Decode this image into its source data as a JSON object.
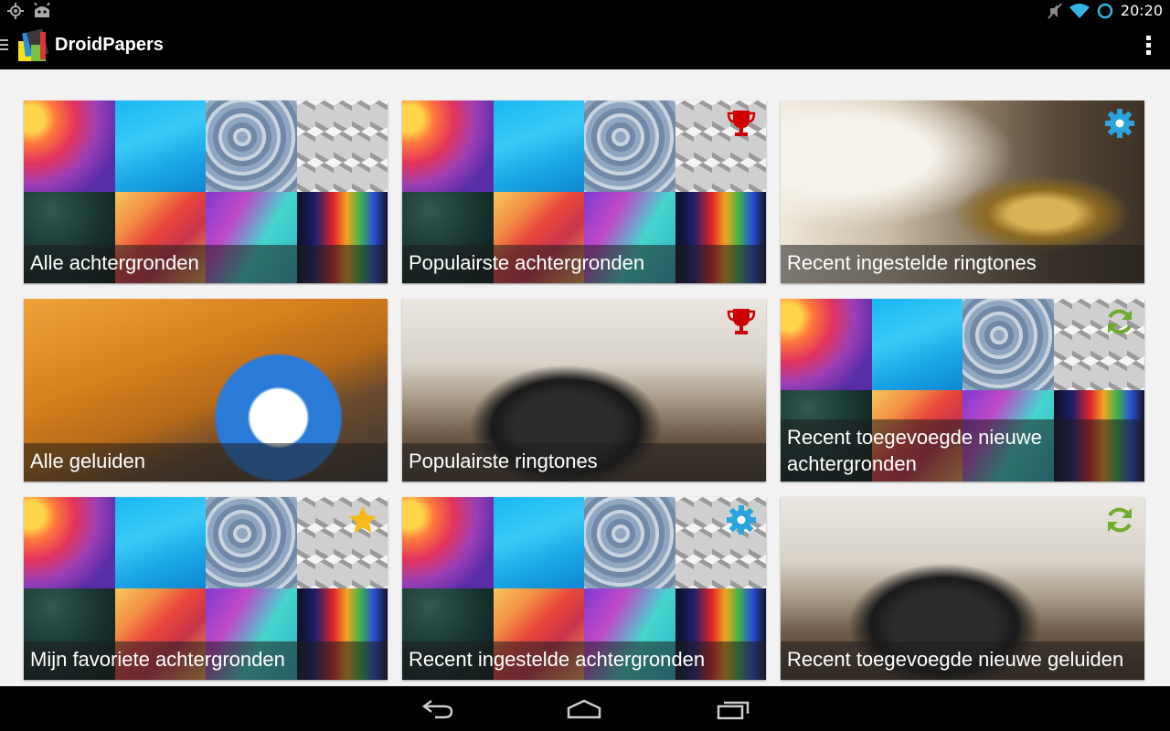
{
  "status_bar": {
    "time": "20:20",
    "left_icons": [
      "location-icon",
      "android-icon"
    ],
    "right_icons": [
      "mute-icon",
      "wifi-icon",
      "sync-circle-icon"
    ]
  },
  "action_bar": {
    "title": "DroidPapers",
    "icons": [
      "drawer-icon",
      "app-logo-icon",
      "overflow-menu-icon"
    ]
  },
  "colors": {
    "trophy": "#cc0000",
    "gear": "#2ba3dc",
    "refresh": "#6cab2e",
    "star": "#f7b917"
  },
  "cards": [
    {
      "label": "Alle achtergronden",
      "badge": "",
      "background": "mosaic"
    },
    {
      "label": "Populairste achtergronden",
      "badge": "trophy-icon",
      "background": "mosaic"
    },
    {
      "label": "Recent ingestelde ringtones",
      "badge": "gear-icon",
      "background": "bell-photo"
    },
    {
      "label": "Alle geluiden",
      "badge": "",
      "background": "alarm-clock-photo"
    },
    {
      "label": "Populairste ringtones",
      "badge": "trophy-icon",
      "background": "telephone-photo"
    },
    {
      "label": "Recent toegevoegde nieuwe achtergronden",
      "badge": "refresh-icon",
      "background": "mosaic"
    },
    {
      "label": "Mijn favoriete achtergronden",
      "badge": "star-icon",
      "background": "mosaic"
    },
    {
      "label": "Recent ingestelde achtergronden",
      "badge": "gear-icon",
      "background": "mosaic"
    },
    {
      "label": "Recent toegevoegde nieuwe geluiden",
      "badge": "refresh-icon",
      "background": "telephone-photo"
    }
  ],
  "nav_bar": {
    "buttons": [
      "back-icon",
      "home-icon",
      "recents-icon"
    ]
  }
}
